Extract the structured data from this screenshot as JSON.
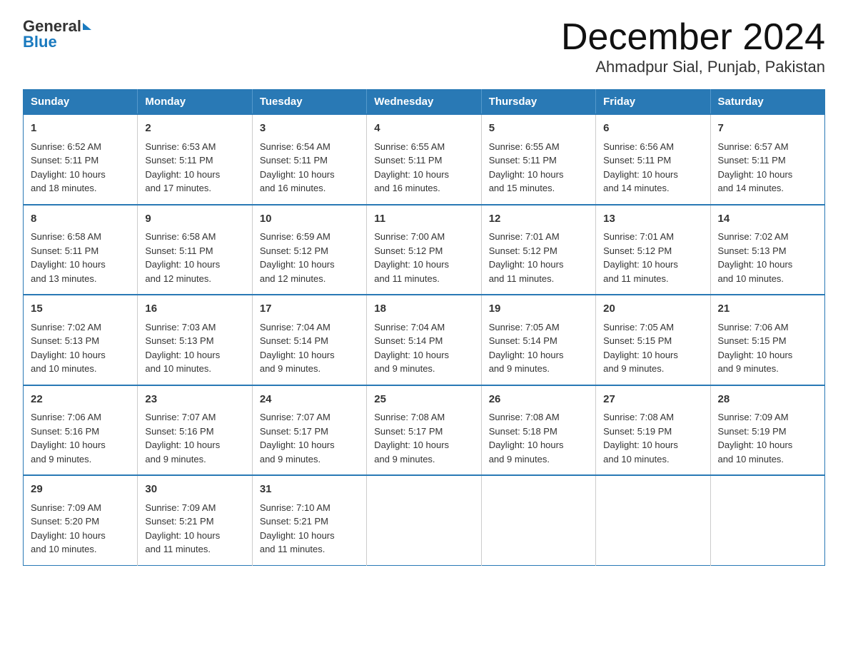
{
  "logo": {
    "general": "General",
    "blue": "Blue"
  },
  "header": {
    "month": "December 2024",
    "location": "Ahmadpur Sial, Punjab, Pakistan"
  },
  "weekdays": [
    "Sunday",
    "Monday",
    "Tuesday",
    "Wednesday",
    "Thursday",
    "Friday",
    "Saturday"
  ],
  "weeks": [
    [
      {
        "day": "1",
        "sunrise": "6:52 AM",
        "sunset": "5:11 PM",
        "daylight": "10 hours and 18 minutes."
      },
      {
        "day": "2",
        "sunrise": "6:53 AM",
        "sunset": "5:11 PM",
        "daylight": "10 hours and 17 minutes."
      },
      {
        "day": "3",
        "sunrise": "6:54 AM",
        "sunset": "5:11 PM",
        "daylight": "10 hours and 16 minutes."
      },
      {
        "day": "4",
        "sunrise": "6:55 AM",
        "sunset": "5:11 PM",
        "daylight": "10 hours and 16 minutes."
      },
      {
        "day": "5",
        "sunrise": "6:55 AM",
        "sunset": "5:11 PM",
        "daylight": "10 hours and 15 minutes."
      },
      {
        "day": "6",
        "sunrise": "6:56 AM",
        "sunset": "5:11 PM",
        "daylight": "10 hours and 14 minutes."
      },
      {
        "day": "7",
        "sunrise": "6:57 AM",
        "sunset": "5:11 PM",
        "daylight": "10 hours and 14 minutes."
      }
    ],
    [
      {
        "day": "8",
        "sunrise": "6:58 AM",
        "sunset": "5:11 PM",
        "daylight": "10 hours and 13 minutes."
      },
      {
        "day": "9",
        "sunrise": "6:58 AM",
        "sunset": "5:11 PM",
        "daylight": "10 hours and 12 minutes."
      },
      {
        "day": "10",
        "sunrise": "6:59 AM",
        "sunset": "5:12 PM",
        "daylight": "10 hours and 12 minutes."
      },
      {
        "day": "11",
        "sunrise": "7:00 AM",
        "sunset": "5:12 PM",
        "daylight": "10 hours and 11 minutes."
      },
      {
        "day": "12",
        "sunrise": "7:01 AM",
        "sunset": "5:12 PM",
        "daylight": "10 hours and 11 minutes."
      },
      {
        "day": "13",
        "sunrise": "7:01 AM",
        "sunset": "5:12 PM",
        "daylight": "10 hours and 11 minutes."
      },
      {
        "day": "14",
        "sunrise": "7:02 AM",
        "sunset": "5:13 PM",
        "daylight": "10 hours and 10 minutes."
      }
    ],
    [
      {
        "day": "15",
        "sunrise": "7:02 AM",
        "sunset": "5:13 PM",
        "daylight": "10 hours and 10 minutes."
      },
      {
        "day": "16",
        "sunrise": "7:03 AM",
        "sunset": "5:13 PM",
        "daylight": "10 hours and 10 minutes."
      },
      {
        "day": "17",
        "sunrise": "7:04 AM",
        "sunset": "5:14 PM",
        "daylight": "10 hours and 9 minutes."
      },
      {
        "day": "18",
        "sunrise": "7:04 AM",
        "sunset": "5:14 PM",
        "daylight": "10 hours and 9 minutes."
      },
      {
        "day": "19",
        "sunrise": "7:05 AM",
        "sunset": "5:14 PM",
        "daylight": "10 hours and 9 minutes."
      },
      {
        "day": "20",
        "sunrise": "7:05 AM",
        "sunset": "5:15 PM",
        "daylight": "10 hours and 9 minutes."
      },
      {
        "day": "21",
        "sunrise": "7:06 AM",
        "sunset": "5:15 PM",
        "daylight": "10 hours and 9 minutes."
      }
    ],
    [
      {
        "day": "22",
        "sunrise": "7:06 AM",
        "sunset": "5:16 PM",
        "daylight": "10 hours and 9 minutes."
      },
      {
        "day": "23",
        "sunrise": "7:07 AM",
        "sunset": "5:16 PM",
        "daylight": "10 hours and 9 minutes."
      },
      {
        "day": "24",
        "sunrise": "7:07 AM",
        "sunset": "5:17 PM",
        "daylight": "10 hours and 9 minutes."
      },
      {
        "day": "25",
        "sunrise": "7:08 AM",
        "sunset": "5:17 PM",
        "daylight": "10 hours and 9 minutes."
      },
      {
        "day": "26",
        "sunrise": "7:08 AM",
        "sunset": "5:18 PM",
        "daylight": "10 hours and 9 minutes."
      },
      {
        "day": "27",
        "sunrise": "7:08 AM",
        "sunset": "5:19 PM",
        "daylight": "10 hours and 10 minutes."
      },
      {
        "day": "28",
        "sunrise": "7:09 AM",
        "sunset": "5:19 PM",
        "daylight": "10 hours and 10 minutes."
      }
    ],
    [
      {
        "day": "29",
        "sunrise": "7:09 AM",
        "sunset": "5:20 PM",
        "daylight": "10 hours and 10 minutes."
      },
      {
        "day": "30",
        "sunrise": "7:09 AM",
        "sunset": "5:21 PM",
        "daylight": "10 hours and 11 minutes."
      },
      {
        "day": "31",
        "sunrise": "7:10 AM",
        "sunset": "5:21 PM",
        "daylight": "10 hours and 11 minutes."
      },
      null,
      null,
      null,
      null
    ]
  ],
  "labels": {
    "sunrise": "Sunrise:",
    "sunset": "Sunset:",
    "daylight": "Daylight:"
  }
}
